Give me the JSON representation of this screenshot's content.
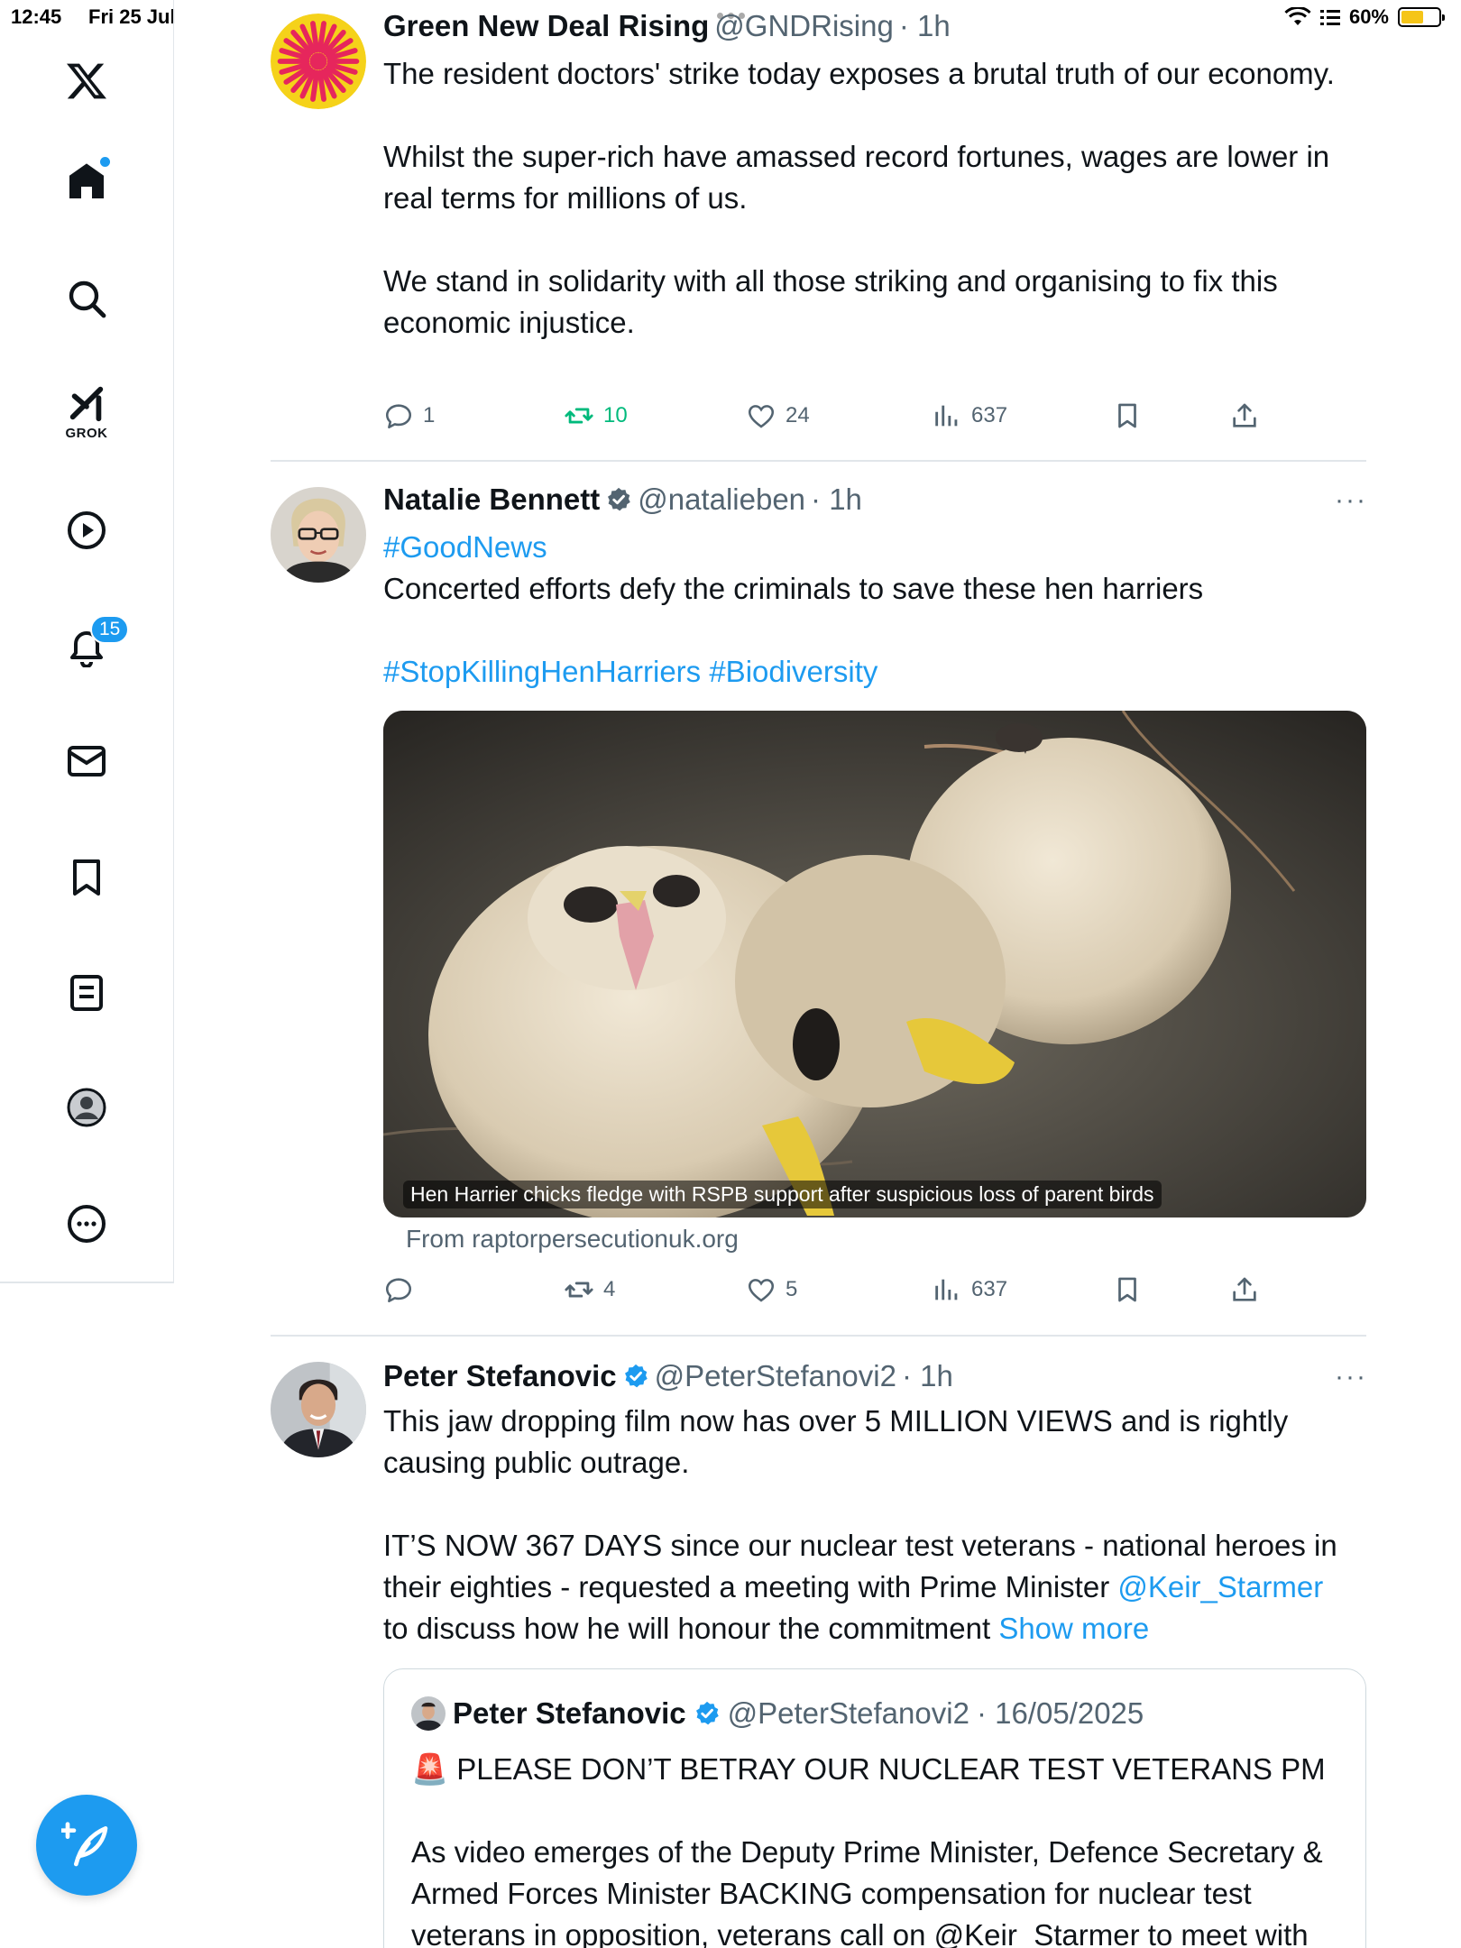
{
  "status_bar": {
    "time": "12:45",
    "date": "Fri 25 Jul",
    "battery_percent": "60%",
    "battery_level": 0.6
  },
  "sidebar": {
    "grok_label": "GROK",
    "notification_count": "15",
    "items": [
      "x-logo",
      "home-icon",
      "search-icon",
      "grok-icon",
      "video-icon",
      "bell-icon",
      "mail-icon",
      "bookmark-icon",
      "list-icon",
      "profile-icon",
      "more-icon"
    ]
  },
  "colors": {
    "accent": "#1d9bf0",
    "retweet_active": "#00ba7c",
    "muted": "#536471"
  },
  "posts": [
    {
      "author": "Green New Deal Rising",
      "handle": "@GNDRising",
      "time": "· 1h",
      "text": "The resident doctors' strike today exposes a brutal truth of our economy.\n\nWhilst the super-rich have amassed record fortunes, wages are lower in real terms for millions of us.\n\nWe stand in solidarity with all those striking and organising to fix this economic injustice.",
      "replies": "1",
      "retweets": "10",
      "likes": "24",
      "views": "637"
    },
    {
      "author": "Natalie Bennett",
      "handle": "@natalieben",
      "time": "· 1h",
      "hashtag_top": "#GoodNews",
      "text": "Concerted efforts defy the criminals to save these hen harriers",
      "hashtags_bottom": "#StopKillingHenHarriers #Biodiversity",
      "media_caption": "Hen Harrier chicks fledge with RSPB support after suspicious loss of parent birds",
      "card_source": "From raptorpersecutionuk.org",
      "replies": "",
      "retweets": "4",
      "likes": "5",
      "views": "637"
    },
    {
      "author": "Peter Stefanovic",
      "handle": "@PeterStefanovi2",
      "time": "· 1h",
      "text_part1": "This jaw dropping film now has over 5 MILLION VIEWS and is rightly causing public outrage.\n\nIT’S NOW 367 DAYS since our nuclear test veterans - national heroes in their eighties - requested a meeting with Prime Minister ",
      "mention": "@Keir_Starmer",
      "text_part2": "\nto discuss how he will honour the commitment ",
      "show_more": "Show more",
      "quote": {
        "author": "Peter Stefanovic",
        "handle": "@PeterStefanovi2",
        "time": "· 16/05/2025",
        "text": "🚨 PLEASE DON’T BETRAY OUR NUCLEAR TEST VETERANS PM\n\nAs video emerges of the Deputy Prime Minister, Defence Secretary & Armed Forces Minister BACKING compensation for nuclear test veterans in opposition, veterans call on @Keir_Starmer to meet with"
      }
    }
  ]
}
